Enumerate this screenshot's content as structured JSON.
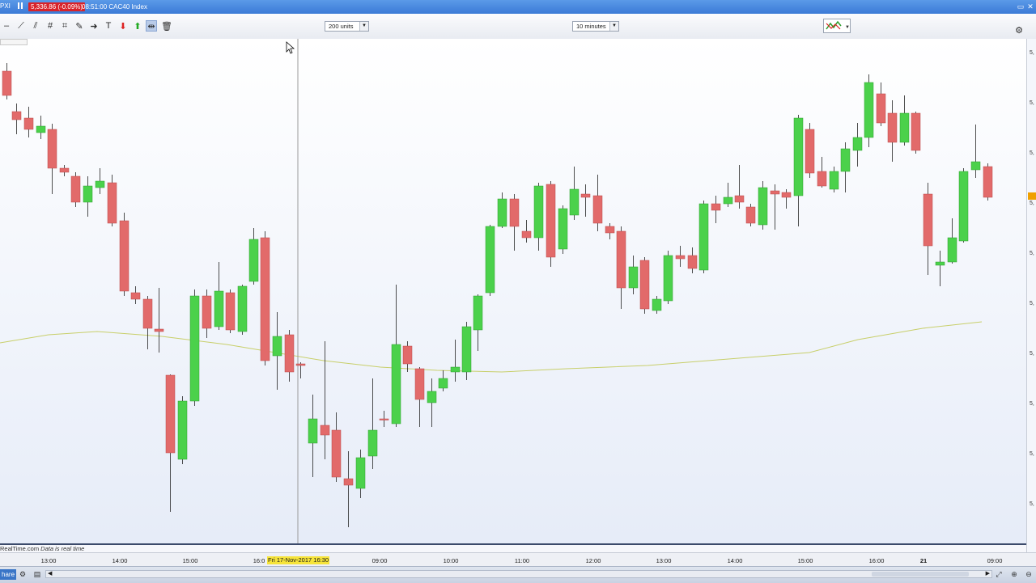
{
  "titlebar": {
    "left_label": "PXI",
    "price_badge": "5,336.86 (-0.09%)",
    "title_text": "08:51:00 CAC40 Index",
    "buttons": [
      "restore-icon",
      "close-icon"
    ]
  },
  "toolbar": {
    "units_select": "200 units",
    "interval_select": "10 minutes",
    "tools": [
      "line-icon",
      "trend-line-icon",
      "multi-line-icon",
      "fibonacci-icon",
      "gann-icon",
      "arrow-icon",
      "text-icon",
      "sell-arrow-icon",
      "buy-arrow-icon",
      "horizontal-line-icon",
      "trash-icon"
    ]
  },
  "chart": {
    "credit_site": "RealTime.com",
    "credit_note": "Data is real time",
    "crosshair_time_label": "Fri 17-Nov-2017 16:30",
    "time_labels": [
      {
        "text": "13:00",
        "bold": false
      },
      {
        "text": "14:00",
        "bold": false
      },
      {
        "text": "15:00",
        "bold": false
      },
      {
        "text": "16:0",
        "bold": false
      },
      {
        "text": "09:00",
        "bold": false
      },
      {
        "text": "10:00",
        "bold": false
      },
      {
        "text": "11:00",
        "bold": false
      },
      {
        "text": "12:00",
        "bold": false
      },
      {
        "text": "13:00",
        "bold": false
      },
      {
        "text": "14:00",
        "bold": false
      },
      {
        "text": "15:00",
        "bold": false
      },
      {
        "text": "16:00",
        "bold": false
      },
      {
        "text": "21",
        "bold": true
      },
      {
        "text": "09:00",
        "bold": false
      }
    ],
    "right_axis_labels": [
      "5,",
      "5,",
      "5,",
      "5,",
      "5,",
      "5,",
      "5,",
      "5,",
      "5,",
      "5,"
    ],
    "colors": {
      "up": "#4bd14b",
      "down": "#e26a6a",
      "wick": "#222222",
      "ma": "#c8cf6a",
      "crosshair": "#9a9a9a"
    }
  },
  "bottombar": {
    "share_label": "hare",
    "icons": [
      "settings-icon",
      "print-icon",
      "scroll-left-icon",
      "scroll-right-icon",
      "expand-icon",
      "zoom-in-icon",
      "zoom-out-icon"
    ]
  }
}
